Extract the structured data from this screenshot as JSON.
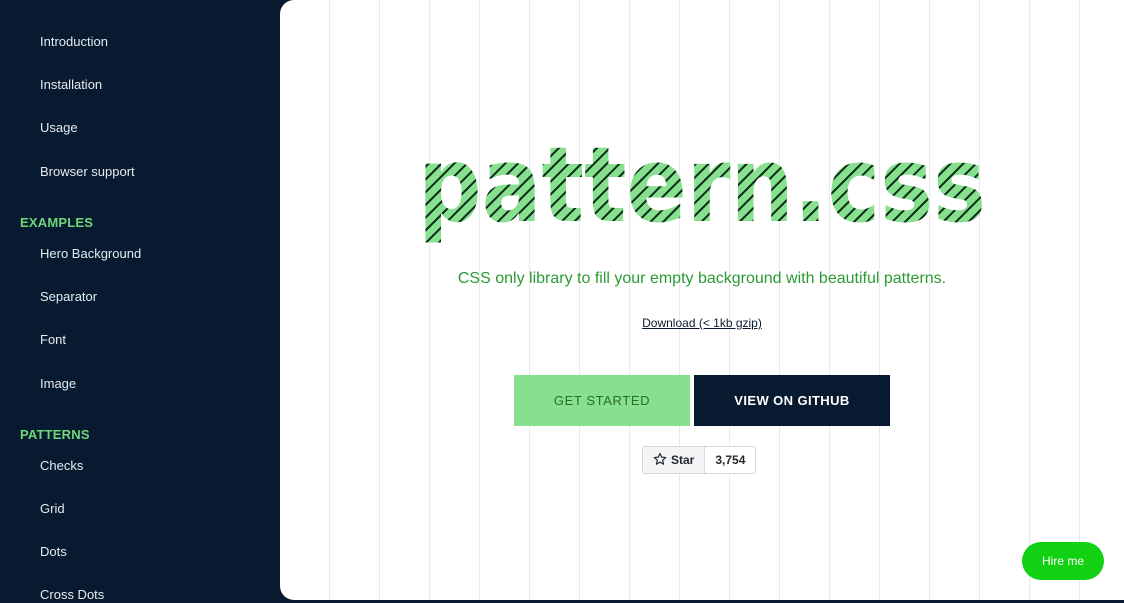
{
  "sidebar": {
    "intro_items": [
      "Introduction",
      "Installation",
      "Usage",
      "Browser support"
    ],
    "examples_heading": "EXAMPLES",
    "examples_items": [
      "Hero Background",
      "Separator",
      "Font",
      "Image"
    ],
    "patterns_heading": "PATTERNS",
    "patterns_items": [
      "Checks",
      "Grid",
      "Dots",
      "Cross Dots"
    ]
  },
  "hero": {
    "logo_text": "pattern.css",
    "tagline": "CSS only library to fill your empty background with beautiful patterns.",
    "download_label": "Download (< 1kb gzip)",
    "get_started_label": "GET STARTED",
    "github_label": "VIEW ON GITHUB",
    "star_label": "Star",
    "star_count": "3,754",
    "hire_label": "Hire me"
  },
  "colors": {
    "sidebar_bg": "#081a2f",
    "accent_green": "#6fd67a",
    "logo_green": "#86e08d",
    "tagline_green": "#2b9a34",
    "hire_green": "#12d012"
  },
  "icons": {
    "star": "star-outline-icon"
  }
}
